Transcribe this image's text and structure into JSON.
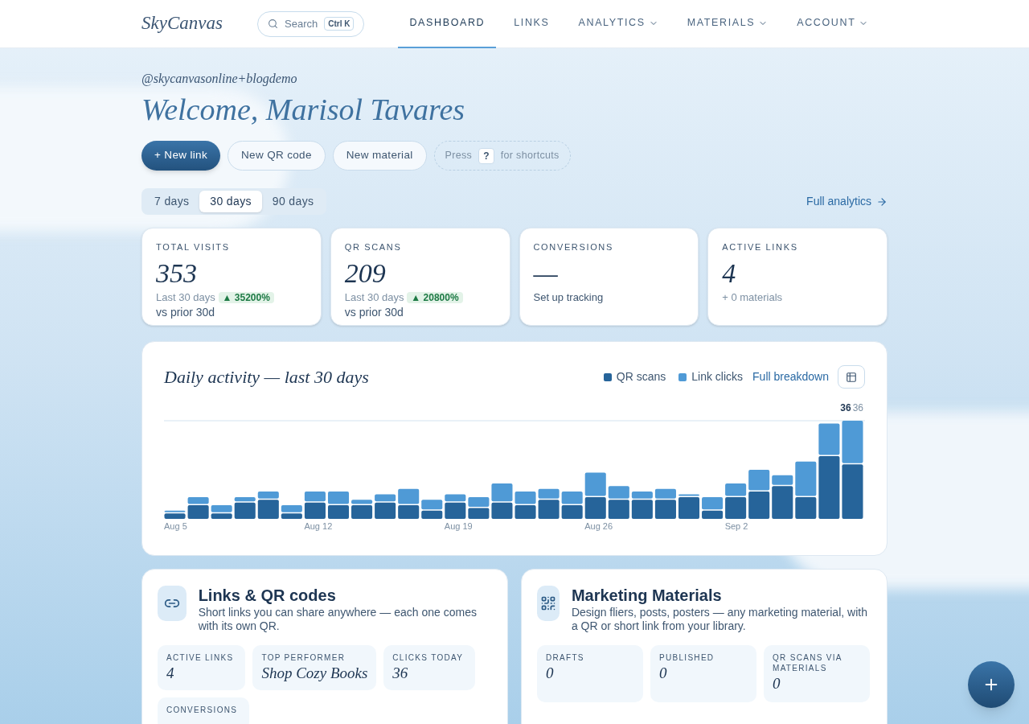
{
  "header": {
    "logo": "SkyCanvas",
    "search": {
      "placeholder": "Search",
      "shortcut": "Ctrl K"
    },
    "nav": [
      {
        "label": "DASHBOARD",
        "selected": true,
        "dropdown": false
      },
      {
        "label": "LINKS",
        "selected": false,
        "dropdown": false
      },
      {
        "label": "ANALYTICS",
        "selected": false,
        "dropdown": true
      },
      {
        "label": "MATERIALS",
        "selected": false,
        "dropdown": true
      },
      {
        "label": "ACCOUNT",
        "selected": false,
        "dropdown": true
      }
    ]
  },
  "handle": "@skycanvasonline+blogdemo",
  "welcome": "Welcome, Marisol Tavares",
  "actions": [
    {
      "label": "+ New link",
      "kind": "primary"
    },
    {
      "label": "New QR code",
      "kind": "secondary"
    },
    {
      "label": "New material",
      "kind": "secondary"
    }
  ],
  "shortcut_hint": {
    "before": "Press",
    "key": "?",
    "after": "for shortcuts"
  },
  "ranges": [
    {
      "label": "7 days",
      "selected": false
    },
    {
      "label": "30 days",
      "selected": true
    },
    {
      "label": "90 days",
      "selected": false
    }
  ],
  "full_analytics": "Full analytics",
  "stats": [
    {
      "label": "TOTAL VISITS",
      "value": "353",
      "period": "Last 30 days",
      "change": "▲ 35200%",
      "suffix": "vs prior 30d"
    },
    {
      "label": "QR SCANS",
      "value": "209",
      "period": "Last 30 days",
      "change": "▲ 20800%",
      "suffix": "vs prior 30d"
    },
    {
      "label": "CONVERSIONS",
      "value": "—",
      "note": "Set up tracking"
    },
    {
      "label": "ACTIVE LINKS",
      "value": "4",
      "note": "+ 0 materials"
    }
  ],
  "activity": {
    "title": "Daily activity — last 30 days",
    "legend": [
      "QR scans",
      "Link clicks"
    ],
    "link": "Full breakdown",
    "axis_labels": [
      "Aug 5",
      "Aug 12",
      "Aug 19",
      "Aug 26",
      "Sep 2"
    ],
    "peak_labels": [
      "36",
      "36"
    ]
  },
  "links_panel": {
    "title": "Links & QR codes",
    "description": "Short links you can share anywhere — each one comes with its own QR.",
    "stats": [
      {
        "label": "ACTIVE LINKS",
        "value": "4"
      },
      {
        "label": "TOP PERFORMER",
        "value": "Shop Cozy Books"
      },
      {
        "label": "CLICKS TODAY",
        "value": "36"
      },
      {
        "label": "CONVERSIONS"
      }
    ]
  },
  "materials_panel": {
    "title": "Marketing Materials",
    "description": "Design fliers, posts, posters — any marketing material, with a QR or short link from your library.",
    "stats": [
      {
        "label": "DRAFTS",
        "value": "0"
      },
      {
        "label": "PUBLISHED",
        "value": "0"
      },
      {
        "label": "QR SCANS VIA MATERIALS",
        "value": "0"
      }
    ]
  }
}
